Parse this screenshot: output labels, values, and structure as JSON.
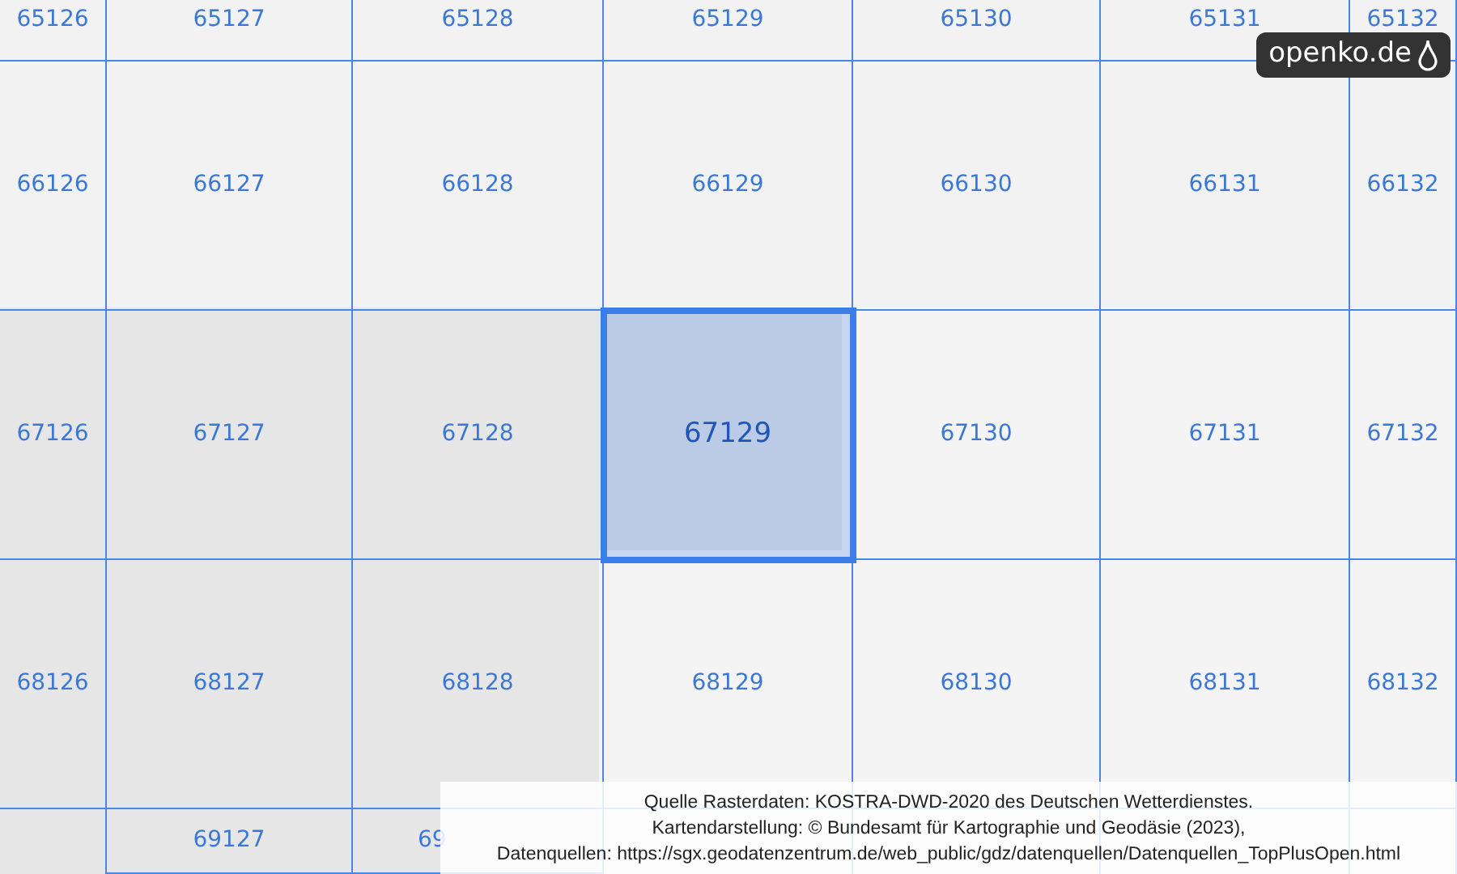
{
  "map": {
    "grid": [
      {
        "cells": [
          {
            "label": "65126",
            "selected": false
          },
          {
            "label": "65127",
            "selected": false
          },
          {
            "label": "65128",
            "selected": false
          },
          {
            "label": "65129",
            "selected": false
          },
          {
            "label": "65130",
            "selected": false
          },
          {
            "label": "65131",
            "selected": false
          },
          {
            "label": "65132",
            "selected": false
          }
        ]
      },
      {
        "cells": [
          {
            "label": "66126",
            "selected": false
          },
          {
            "label": "66127",
            "selected": false
          },
          {
            "label": "66128",
            "selected": false
          },
          {
            "label": "66129",
            "selected": false
          },
          {
            "label": "66130",
            "selected": false
          },
          {
            "label": "66131",
            "selected": false
          },
          {
            "label": "66132",
            "selected": false
          }
        ]
      },
      {
        "cells": [
          {
            "label": "67126",
            "selected": false
          },
          {
            "label": "67127",
            "selected": false
          },
          {
            "label": "67128",
            "selected": false
          },
          {
            "label": "67129",
            "selected": true
          },
          {
            "label": "67130",
            "selected": false
          },
          {
            "label": "67131",
            "selected": false
          },
          {
            "label": "67132",
            "selected": false
          }
        ]
      },
      {
        "cells": [
          {
            "label": "68126",
            "selected": false
          },
          {
            "label": "68127",
            "selected": false
          },
          {
            "label": "68128",
            "selected": false
          },
          {
            "label": "68129",
            "selected": false
          },
          {
            "label": "68130",
            "selected": false
          },
          {
            "label": "68131",
            "selected": false
          },
          {
            "label": "68132",
            "selected": false
          }
        ]
      },
      {
        "cells": [
          null,
          {
            "label": "69127",
            "selected": false
          },
          {
            "label": "69",
            "selected": false,
            "clipped": true
          },
          null,
          null,
          null,
          null
        ]
      }
    ]
  },
  "logo": {
    "text": "openko.de"
  },
  "attribution": [
    "Quelle Rasterdaten: KOSTRA-DWD-2020 des Deutschen Wetterdienstes.",
    "Kartendarstellung: © Bundesamt für Kartographie und Geodäsie (2023),",
    "Datenquellen: https://sgx.geodatenzentrum.de/web_public/gdz/datenquellen/Datenquellen_TopPlusOpen.html"
  ]
}
